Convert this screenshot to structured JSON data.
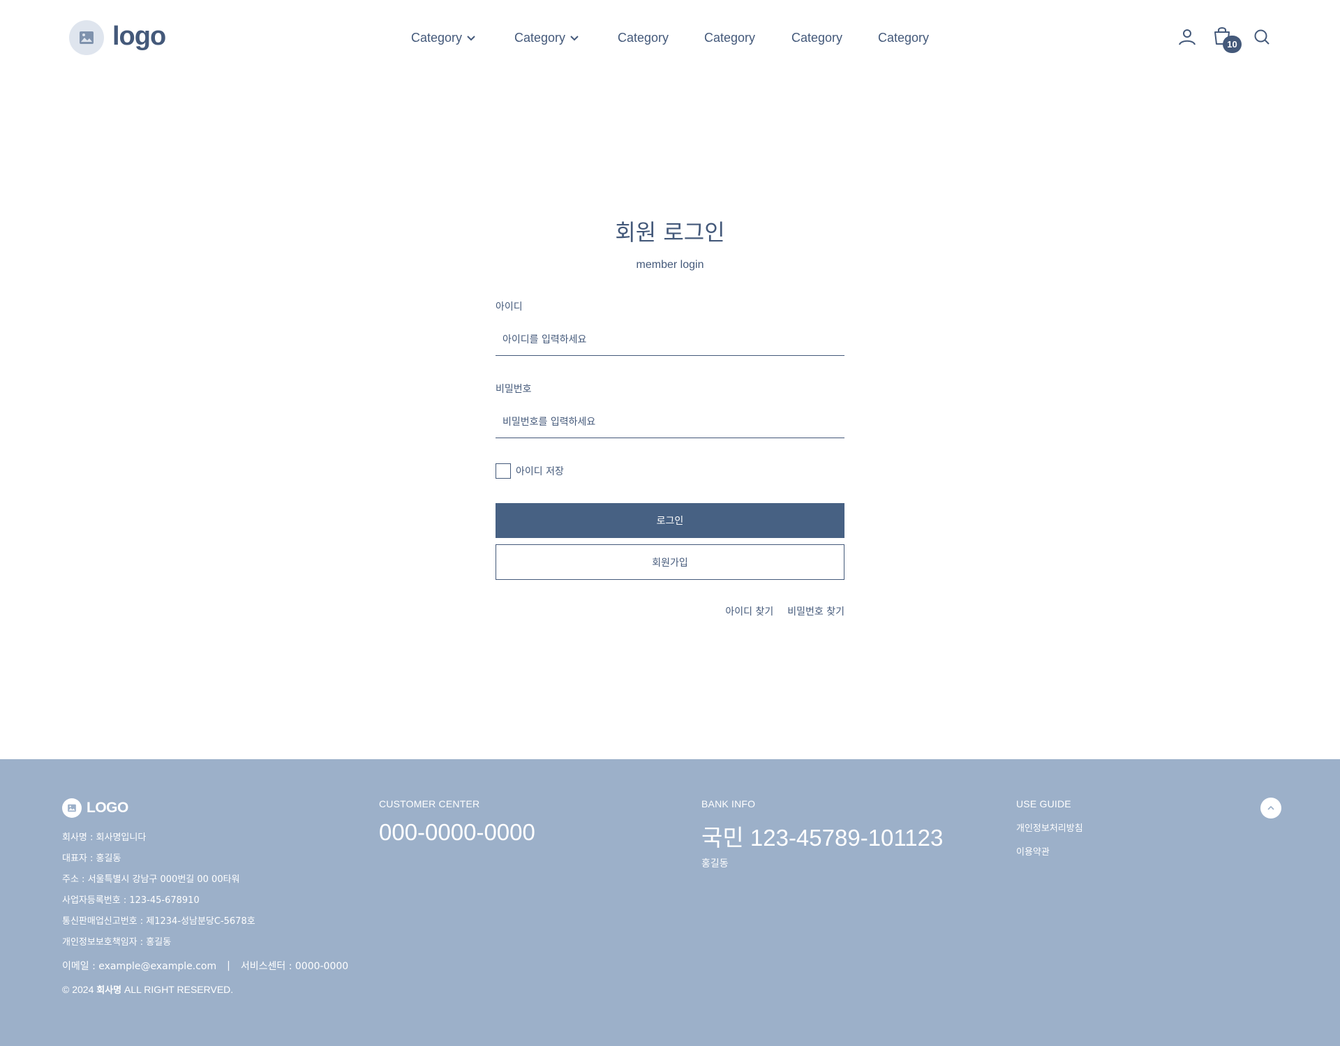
{
  "header": {
    "logo_text": "logo",
    "nav": [
      {
        "label": "Category",
        "has_dropdown": true
      },
      {
        "label": "Category",
        "has_dropdown": true
      },
      {
        "label": "Category",
        "has_dropdown": false
      },
      {
        "label": "Category",
        "has_dropdown": false
      },
      {
        "label": "Category",
        "has_dropdown": false
      },
      {
        "label": "Category",
        "has_dropdown": false
      }
    ],
    "icons": [
      "user-icon",
      "cart-icon",
      "search-icon"
    ],
    "cart_count": "10"
  },
  "login": {
    "title": "회원 로그인",
    "subtitle": "member login",
    "id_label": "아이디",
    "id_placeholder": "아이디를 입력하세요",
    "pw_label": "비밀번호",
    "pw_placeholder": "비밀번호를 입력하세요",
    "remember_label": "아이디 저장",
    "login_button": "로그인",
    "join_button": "회원가입",
    "find_id": "아이디 찾기",
    "find_pw": "비밀번호 찾기"
  },
  "footer": {
    "logo_text": "LOGO",
    "company_lines": [
      "회사명 : 회사명입니다",
      "대표자 : 홍길동",
      "주소 : 서울특별시 강남구 000번길 00 00타워",
      "사업자등록번호 : 123-45-678910",
      "통신판매업신고번호 : 제1234-성남분당C-5678호",
      "개인정보보호책임자 : 홍길동"
    ],
    "email": "이메일 : example@example.com",
    "separator": "|",
    "service_center": "서비스센터 : 0000-0000",
    "copyright_prefix": "© 2024",
    "copyright_company": "회사명",
    "copyright_suffix": "ALL RIGHT RESERVED.",
    "customer_center_heading": "CUSTOMER CENTER",
    "customer_center_phone": "000-0000-0000",
    "bank_heading": "BANK INFO",
    "bank_account": "국민 123-45789-101123",
    "bank_holder": "홍길동",
    "guide_heading": "USE GUIDE",
    "guide_links": [
      "개인정보처리방침",
      "이용약관"
    ]
  },
  "colors": {
    "primary": "#476183",
    "text": "#44597a",
    "footer_bg": "#9cb0c9",
    "logo_circle": "#dfe5ee"
  }
}
